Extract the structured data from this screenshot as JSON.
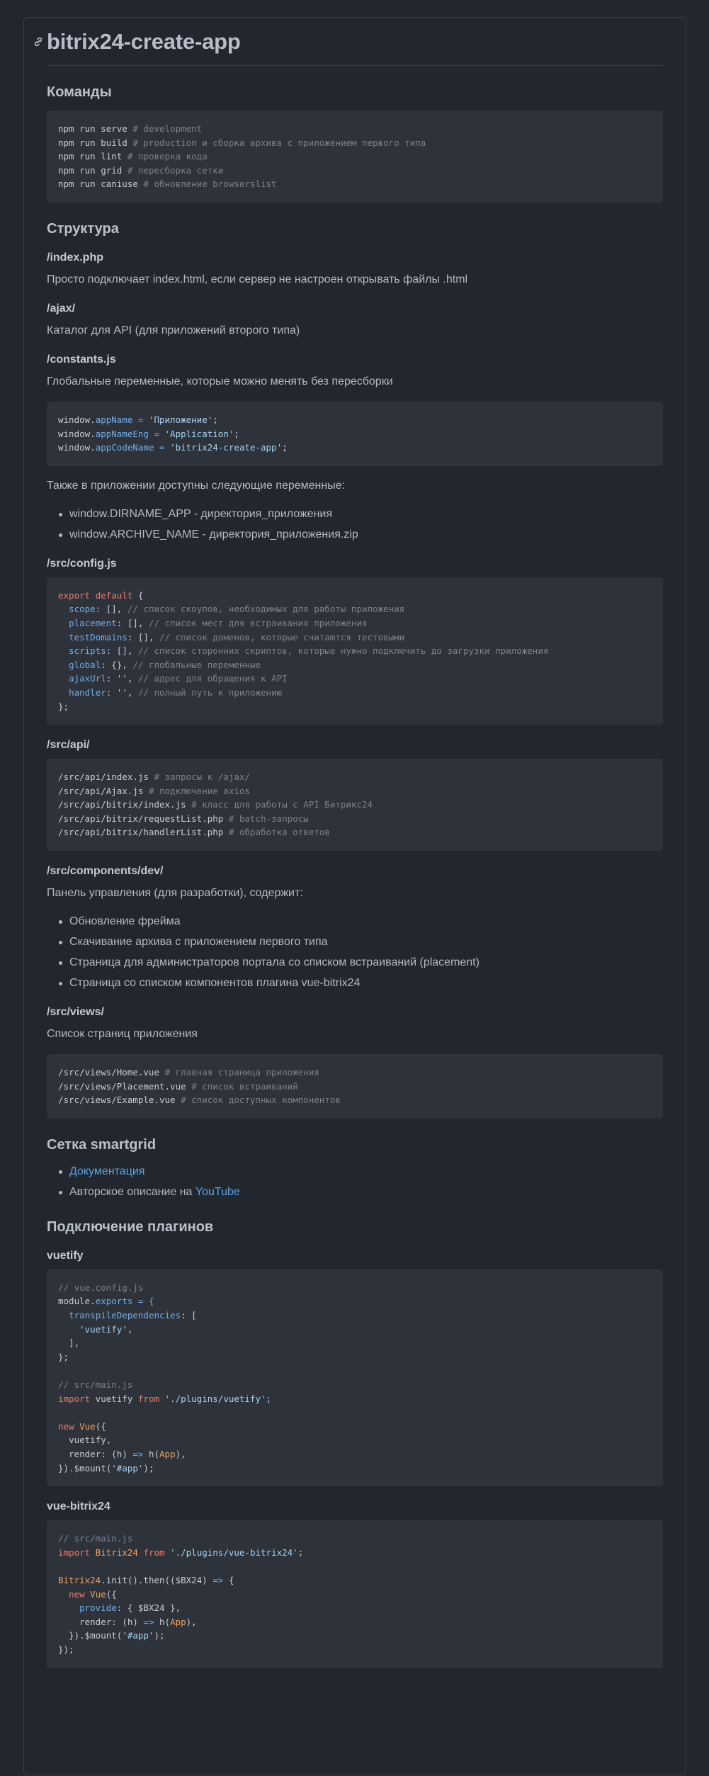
{
  "title": "bitrix24-create-app",
  "sections": {
    "commands": {
      "heading": "Команды",
      "code": [
        {
          "cmd": "npm run serve ",
          "comment": "# development"
        },
        {
          "cmd": "npm run build ",
          "comment": "# production и сборка архива с приложением первого типа"
        },
        {
          "cmd": "npm run lint ",
          "comment": "# проверка кода"
        },
        {
          "cmd": "npm run grid ",
          "comment": "# пересборка сетки"
        },
        {
          "cmd": "npm run caniuse ",
          "comment": "# обновление browserslist"
        }
      ]
    },
    "structure": {
      "heading": "Структура",
      "index_php": {
        "heading": "/index.php",
        "text": "Просто подключает index.html, если сервер не настроен открывать файлы .html"
      },
      "ajax": {
        "heading": "/ajax/",
        "text": "Каталог для API (для приложений второго типа)"
      },
      "constants": {
        "heading": "/constants.js",
        "text": "Глобальные переменные, которые можно менять без пересборки",
        "code": [
          {
            "obj": "window.",
            "prop": "appName",
            "op": " = ",
            "val": "'Приложение'",
            "end": ";"
          },
          {
            "obj": "window.",
            "prop": "appNameEng",
            "op": " = ",
            "val": "'Application'",
            "end": ";"
          },
          {
            "obj": "window.",
            "prop": "appCodeName",
            "op": " = ",
            "val": "'bitrix24-create-app'",
            "end": ";"
          }
        ],
        "also_text": "Также в приложении доступны следующие переменные:",
        "vars": [
          "window.DIRNAME_APP - директория_приложения",
          "window.ARCHIVE_NAME - директория_приложения.zip"
        ]
      },
      "config": {
        "heading": "/src/config.js",
        "export": "export",
        "default": "default",
        "open": " {",
        "lines": [
          {
            "prop": "scope",
            "val": ": [], ",
            "comment": "// список скоупов, необходимых для работы приложения"
          },
          {
            "prop": "placement",
            "val": ": [], ",
            "comment": "// список мест для встраивания приложения"
          },
          {
            "prop": "testDomains",
            "val": ": [], ",
            "comment": "// список доменов, которые считаются тестовыми"
          },
          {
            "prop": "scripts",
            "val": ": [], ",
            "comment": "// список сторонних скриптов, которые нужно подключить до загрузки приложения"
          },
          {
            "prop": "global",
            "val": ": {}, ",
            "comment": "// глобальные переменные"
          },
          {
            "prop": "ajaxUrl",
            "val": ": '', ",
            "comment": "// адрес для обращения к API"
          },
          {
            "prop": "handler",
            "val": ": '', ",
            "comment": "// полный путь к приложению"
          }
        ],
        "close": "};"
      },
      "api": {
        "heading": "/src/api/",
        "code": [
          {
            "path": "/src/api/index.js ",
            "comment": "# запросы к /ajax/"
          },
          {
            "path": "/src/api/Ajax.js ",
            "comment": "# подключение axios"
          },
          {
            "path": "/src/api/bitrix/index.js ",
            "comment": "# класс для работы с API Битрикс24"
          },
          {
            "path": "/src/api/bitrix/requestList.php ",
            "comment": "# batch-запросы"
          },
          {
            "path": "/src/api/bitrix/handlerList.php ",
            "comment": "# обработка ответов"
          }
        ]
      },
      "dev": {
        "heading": "/src/components/dev/",
        "text": "Панель управления (для разработки), содержит:",
        "items": [
          "Обновление фрейма",
          "Скачивание архива с приложением первого типа",
          "Страница для администраторов портала со списком встраиваний (placement)",
          "Страница со списком компонентов плагина vue-bitrix24"
        ]
      },
      "views": {
        "heading": "/src/views/",
        "text": "Список страниц приложения",
        "code": [
          {
            "path": "/src/views/Home.vue ",
            "comment": "# главная страница приложения"
          },
          {
            "path": "/src/views/Placement.vue ",
            "comment": "# список встраиваний"
          },
          {
            "path": "/src/views/Example.vue ",
            "comment": "# список доступных компонентов"
          }
        ]
      }
    },
    "smartgrid": {
      "heading": "Сетка smartgrid",
      "doc_link": "Документация",
      "author_text": "Авторское описание на ",
      "youtube_link": "YouTube"
    },
    "plugins": {
      "heading": "Подключение плагинов",
      "vuetify": {
        "heading": "vuetify",
        "c1": "// vue.config.js",
        "module": "module.",
        "exports": "exports",
        "eq": " = {",
        "transpile": "transpileDependencies",
        "transpile_rest": ": [",
        "vuetify_str": "'vuetify'",
        "comma": ",",
        "arr_close": "],",
        "obj_close": "};",
        "c2": "// src/main.js",
        "import": "import",
        "import_name": " vuetify ",
        "from": "from",
        "path": "'./plugins/vuetify'",
        "semi": ";",
        "new": "new",
        "vue": "Vue",
        "vue_open": "({",
        "vuetify_line": "vuetify,",
        "render_a": "render: (h) ",
        "arrow": "=>",
        "render_b": " h(",
        "app": "App",
        "render_c": "),",
        "mount_a": "}).$mount(",
        "mount_b": "'#app'",
        "mount_c": ");"
      },
      "vue_bitrix24": {
        "heading": "vue-bitrix24",
        "c1": "// src/main.js",
        "import": "import",
        "name": "Bitrix24",
        "from": "from",
        "path": "'./plugins/vue-bitrix24'",
        "semi": ";",
        "init_a": ".init().then(($BX24) ",
        "arrow": "=>",
        "init_b": " {",
        "new": "new",
        "vue": "Vue",
        "vue_open": "({",
        "provide": "provide",
        "provide_rest": ": { $BX24 },",
        "render_a": "render: (h) ",
        "render_b": " h(",
        "app": "App",
        "render_c": "),",
        "mount_a": "}).$mount(",
        "mount_b": "'#app'",
        "mount_c": ");",
        "close": "});"
      }
    }
  },
  "colors": {
    "background": "#23262d",
    "code_bg": "#2d323b",
    "link": "#5ea2e6",
    "keyword": "#ef7b6d",
    "property": "#72aee8",
    "string": "#a9d3f2",
    "comment": "#7b838e"
  }
}
